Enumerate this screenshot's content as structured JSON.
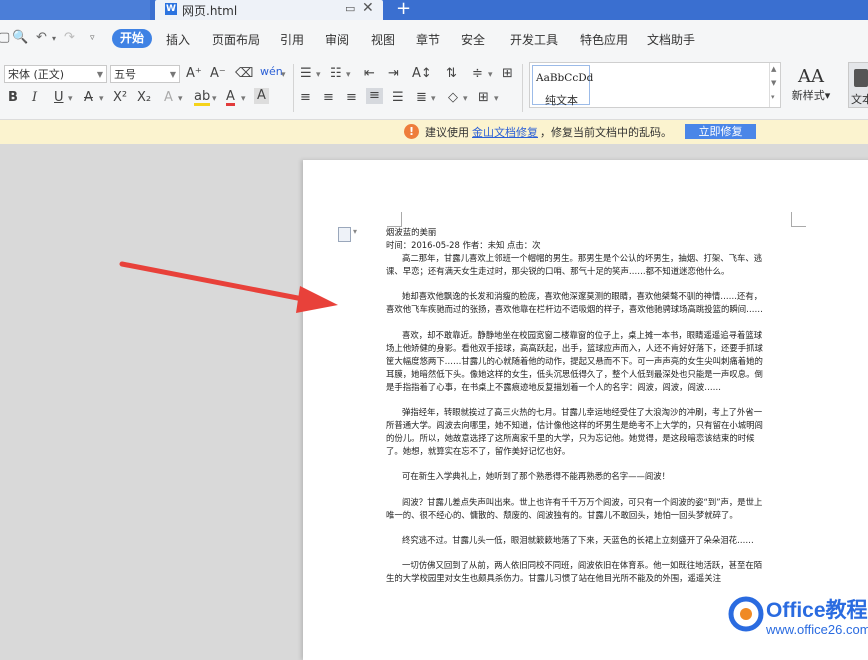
{
  "window": {
    "tab_title": "网页.html",
    "tab_icon": "W",
    "new_tab_symbol": "+"
  },
  "menu": {
    "items": [
      "开始",
      "插入",
      "页面布局",
      "引用",
      "审阅",
      "视图",
      "章节",
      "安全",
      "开发工具",
      "特色应用",
      "文档助手"
    ],
    "active": "开始"
  },
  "toolbar": {
    "font_name": "宋体 (正文)",
    "font_size": "五号",
    "style_sample": "AaBbCcDd",
    "style_name": "纯文本",
    "new_style_label": "新样式",
    "text_label": "文本"
  },
  "notify": {
    "text_before": "建议使用",
    "link_text": "金山文档修复",
    "text_after": "，修复当前文档中的乱码。",
    "button_label": "立即修复"
  },
  "document": {
    "title": "烟波蓝的美丽",
    "meta": "时间：2016-05-28 作者：未知 点击：次",
    "paragraphs": [
      "高二那年，甘露儿喜欢上邻班一个帽帽的男生。那男生是个公认的坏男生，抽烟、打架、飞车、逃课、早恋；还有满天女生走过时，那尖锐的口哨、那气十足的笑声……都不知道迷恋他什么。",
      "她却喜欢他飘逸的长发和消瘦的脸庞，喜欢他深邃莫测的眼睛，喜欢他桀骜不驯的神情……还有，喜欢他飞车疾驰而过的张扬，喜欢他靠在栏杆边不语吸烟的样子，喜欢他驰骋球场高跳投篮的瞬间……",
      "喜欢，却不敢靠近。静静地坐在校园宽窗二楼靠窗的位子上，桌上摊一本书，眼睛遥遥追寻着篮球场上他矫健的身影。看他双手接球，高高跃起，出手，篮球应声而入，人还不肯好好落下，还要手抓球筐大幅度悠两下……甘露儿的心就随着他的动作，提起又悬而不下。可一声声亮的女生尖叫刺痛着她的耳膜，她暗然低下头。像她这样的女生，低头沉思低得久了，整个人低到最深处也只能是一声叹息。倒是手指指着了心事，在书桌上不露痕迹地反复描划着一个人的名字：闾波，闾波，闾波……",
      "弹指经年，转眼就挨过了高三火热的七月。甘露儿幸运地经受住了大浪淘沙的冲刷，考上了外省一所普通大学。闾波去向哪里，她不知道，估计像他这样的坏男生是绝考不上大学的，只有留在小城明闾的份儿。所以，她故意选择了这所离家千里的大学，只为忘记他。她觉得，是这段暗恋该结束的时候了。她想，就算实在忘不了，留作美好记忆也好。",
      "可在新生入学典礼上，她听到了那个熟悉得不能再熟悉的名字——闾波！",
      "闾波？甘露儿差点失声叫出来。世上也许有千千万万个闾波，可只有一个闾波的姿“到”声，是世上唯一的、很不经心的、慵散的、颓废的、闾波独有的。甘露儿不敢回头，她怕一回头梦就碎了。",
      "终究逃不过。甘露儿头一低，眼泪就簌簌地落了下来，天蓝色的长裙上立刻盛开了朵朵泪花……",
      "一切仿佛又回到了从前，两人依旧同校不同班，闾波依旧在体育系。他一如既往地活跃，甚至在陌生的大学校园里对女生也颇具杀伤力。甘露儿习惯了站在他目光所不能及的外围，遥遥关注"
    ]
  },
  "watermark": {
    "line1": "Office教程网",
    "line2": "www.office26.com"
  },
  "colors": {
    "title_bar": "#3a6fd0",
    "accent": "#3f82e4",
    "notify_bg": "#fbf3cf",
    "arrow": "#e8413a"
  }
}
